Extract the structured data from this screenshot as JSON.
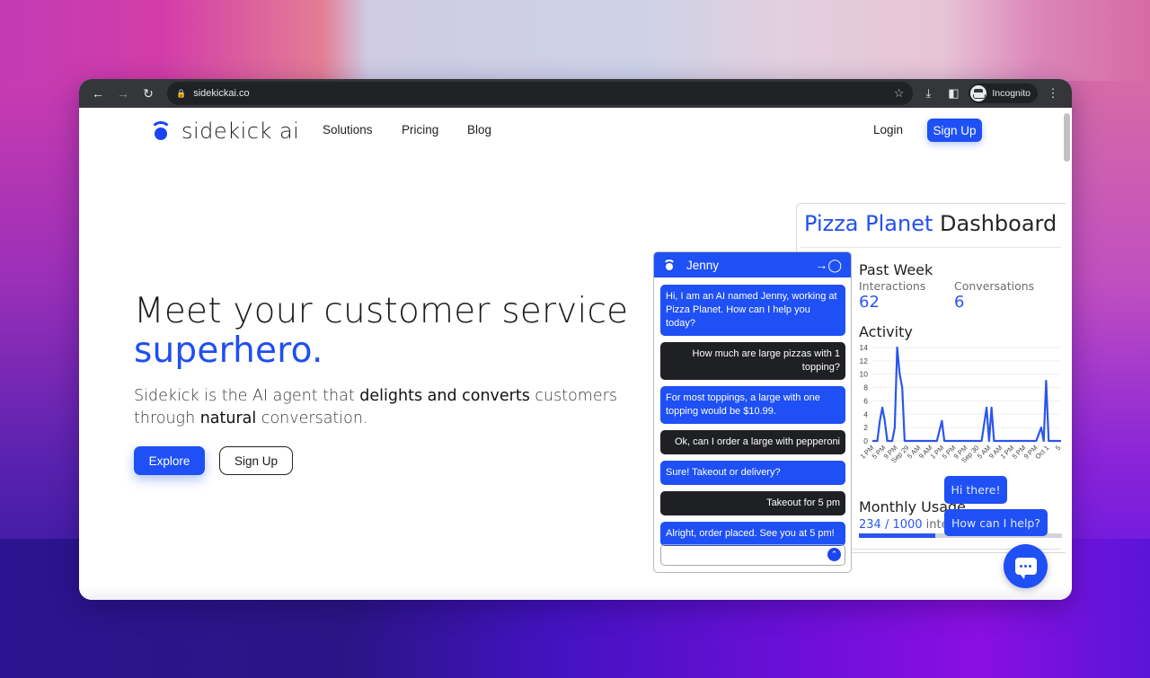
{
  "browser": {
    "url": "sidekickai.co",
    "profile_label": "Incognito",
    "icons": {
      "back": "arrow-left-icon",
      "forward": "arrow-right-icon",
      "reload": "reload-icon",
      "lock": "lock-icon",
      "bookmark": "star-icon",
      "download": "download-icon",
      "side_panel": "side-panel-icon",
      "menu": "kebab-menu-icon"
    }
  },
  "site": {
    "logo_text": "sidekick ai",
    "nav": [
      {
        "label": "Solutions"
      },
      {
        "label": "Pricing"
      },
      {
        "label": "Blog"
      }
    ],
    "login_label": "Login",
    "signup_label": "Sign Up",
    "accent_color": "#1e50f5"
  },
  "hero": {
    "headline": "Meet your customer service",
    "headline_accent": "superhero.",
    "sub_1": "Sidekick is the AI agent that ",
    "sub_bold_1": "delights and converts",
    "sub_2": " customers through ",
    "sub_bold_2": "natural",
    "sub_3": " conversation.",
    "explore_label": "Explore",
    "signup_label": "Sign Up"
  },
  "dashboard": {
    "title_brand": "Pizza Planet",
    "title_rest": " Dashboard",
    "past_week_title": "Past Week",
    "stats": [
      {
        "label": "Interactions",
        "value": "62"
      },
      {
        "label": "Conversations",
        "value": "6"
      }
    ],
    "activity_title": "Activity",
    "monthly_usage_title": "Monthly Usage",
    "monthly_usage_used": "234 / 1000",
    "monthly_usage_suffix": " interactions",
    "monthly_usage_fraction": 0.234
  },
  "chart_data": {
    "type": "line",
    "title": "Activity",
    "xlabel": "",
    "ylabel": "",
    "ylim": [
      0,
      14
    ],
    "yticks": [
      0,
      2,
      4,
      6,
      8,
      10,
      12,
      14
    ],
    "grid": true,
    "x_ticks": [
      "1 PM",
      "5 PM",
      "9 PM",
      "Sep 29",
      "5 AM",
      "9 AM",
      "1 PM",
      "5 PM",
      "9 PM",
      "Sep 30",
      "5 AM",
      "9 AM",
      "1 PM",
      "5 PM",
      "9 PM",
      "Oct 1",
      "5"
    ],
    "series": [
      {
        "name": "Interactions",
        "color": "#2a55ee",
        "x": [
          0,
          1,
          1.5,
          2,
          2.5,
          3,
          4,
          4.5,
          5,
          5.5,
          6,
          6.5,
          7,
          8,
          12,
          13,
          14,
          14.5,
          15,
          16,
          21,
          22,
          23,
          23.5,
          24,
          24.5,
          25,
          25.5,
          26,
          33,
          34,
          34.5,
          35,
          35.5,
          36,
          37,
          38
        ],
        "y": [
          0,
          0,
          3,
          5,
          3,
          0,
          0,
          2,
          14,
          10,
          8,
          0,
          0,
          0,
          0,
          0,
          3,
          0,
          0,
          0,
          0,
          0,
          5,
          0,
          5,
          0,
          0,
          0,
          0,
          0,
          2,
          0,
          9,
          0,
          0,
          0,
          0
        ]
      }
    ]
  },
  "chat": {
    "agent_name": "Jenny",
    "messages": [
      {
        "from": "bot",
        "text": "Hi, I am an AI named Jenny, working at Pizza Planet. How can I help you today?"
      },
      {
        "from": "user",
        "text": "How much are large pizzas with 1 topping?"
      },
      {
        "from": "bot",
        "text": "For most toppings, a large with one topping would be $10.99."
      },
      {
        "from": "user",
        "text": "Ok, can I order a large with pepperoni"
      },
      {
        "from": "bot",
        "text": "Sure! Takeout or delivery?"
      },
      {
        "from": "user",
        "text": "Takeout for 5 pm"
      },
      {
        "from": "bot",
        "text": "Alright, order placed. See you at 5 pm!"
      }
    ],
    "input_value": "",
    "input_placeholder": ""
  },
  "widget": {
    "bubble_1": "Hi there!",
    "bubble_2": "How can I help?"
  }
}
